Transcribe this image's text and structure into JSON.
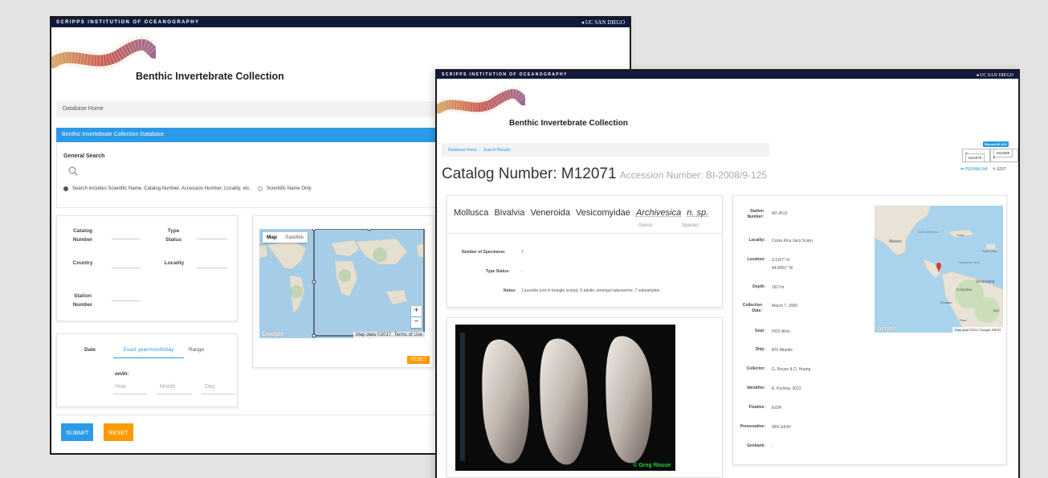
{
  "header": {
    "institution": "SCRIPPS INSTITUTION OF OCEANOGRAPHY",
    "university": "UC SAN DIEGO",
    "site_title": "Benthic Invertebrate Collection"
  },
  "search_page": {
    "breadcrumb": "Database Home",
    "panel_title": "Benthic Invertebrate Collection Database",
    "general_search_label": "General Search",
    "radio_option_1": "Search includes Scientific Name, Catalog Number, Accession Number, Locality, etc.",
    "radio_option_2": "Scientific Name Only",
    "fields": {
      "catalog_number": "Catalog Number",
      "type_status": "Type Status",
      "country": "Country",
      "locality": "Locality",
      "station_number": "Station Number"
    },
    "map": {
      "tab_map": "Map",
      "tab_satellite": "Satellite",
      "zoom_in": "+",
      "zoom_out": "−",
      "attribution": "Map data ©2017",
      "terms": "Terms of Use",
      "google": "Google",
      "reset_label": "RESET"
    },
    "date": {
      "label": "Date",
      "tab_exact": "Exact year/month/day",
      "tab_range": "Range",
      "on_in": "on/in:",
      "year_placeholder": "Year",
      "month_placeholder": "Month",
      "day_placeholder": "Day"
    },
    "submit_label": "SUBMIT",
    "reset_label": "RESET"
  },
  "record_page": {
    "breadcrumb_home": "Database Home",
    "breadcrumb_sep": "/",
    "breadcrumb_results": "Search Results",
    "record_badge": "Record #6 of 6",
    "prev_label": "M12070",
    "next_label": "M12080",
    "permalink_label": "PERMALINK",
    "edit_label": "EDIT",
    "catalog_title": "Catalog Number: M12071",
    "accession": "Accession Number: BI-2008/9-125",
    "taxonomy": {
      "phylum": "Mollusca",
      "class": "Bivalvia",
      "order": "Veneroida",
      "family": "Vesicomyidae",
      "genus": "Archivesica",
      "species": "n. sp.",
      "genus_label": "Genus",
      "species_label": "Species"
    },
    "specimen": {
      "num_label": "Number of Specimens:",
      "num_value": "7",
      "type_label": "Type Status:",
      "type_value": "-",
      "notes_label": "Notes:",
      "notes_value": "1 juvenile (not in triangle scoop), 6 adults; amongst tubeworms. 7 subsamples"
    },
    "photo_credit": "© Greg Rouse",
    "station": [
      {
        "label": "Station Number:",
        "value": "AD 4513"
      },
      {
        "label": "Locality:",
        "value": "Costa Rica Jaco Scarp"
      },
      {
        "label": "Location:",
        "value": "9.1167° N",
        "value2": "84.8051° W"
      },
      {
        "label": "Depth:",
        "value": "1817m"
      },
      {
        "label": "Collection Date:",
        "value": "March 7, 2009"
      },
      {
        "label": "Gear:",
        "value": "HOV Alvin"
      },
      {
        "label": "Ship:",
        "value": "R/V Atlantis"
      },
      {
        "label": "Collector:",
        "value": "G. Rouse & D. Huang"
      },
      {
        "label": "Identifier:",
        "value": "E. Krylova, 2012"
      },
      {
        "label": "Fixative:",
        "value": "EtOH"
      },
      {
        "label": "Preservative:",
        "value": "95% EtOH"
      },
      {
        "label": "Genbank:",
        "value": "-"
      }
    ],
    "map2": {
      "labels": [
        "Mexico",
        "Gulf of Mexico",
        "Cuba",
        "Puerto Rico",
        "Caribbean Sea",
        "Venezuela",
        "Colombia",
        "Ecuador",
        "Peru",
        "Bra"
      ],
      "google": "Google",
      "attribution": "Map data ©2017 Google, INEGI"
    }
  },
  "colors": {
    "topbar": "#111a3c",
    "primary": "#2b9ae8",
    "orange": "#fc9a02"
  }
}
